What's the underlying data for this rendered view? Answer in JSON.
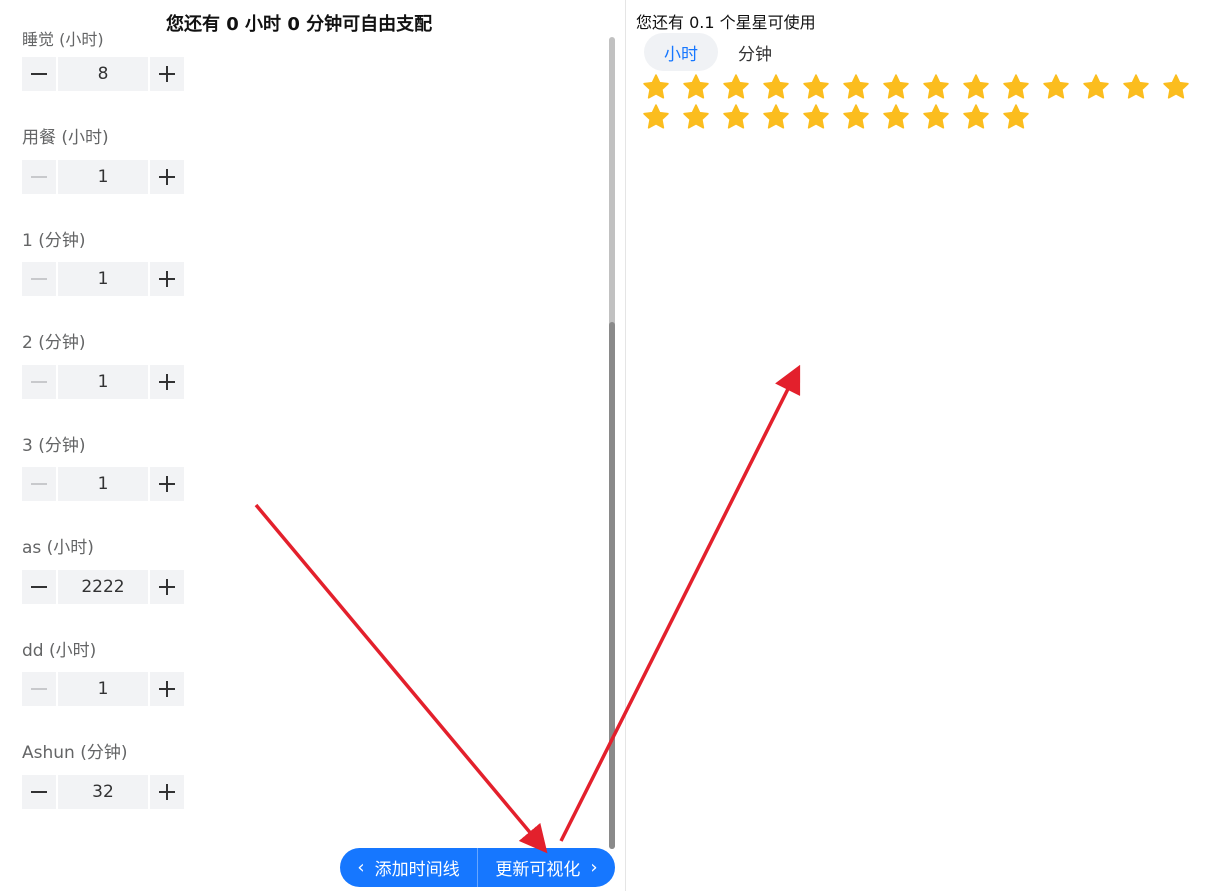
{
  "left": {
    "title": "您还有 0 小时 0 分钟可自由支配",
    "clipped_label": "睡觉 (小时)",
    "fields": [
      {
        "label": "",
        "value": "8"
      },
      {
        "label": "用餐 (小时)",
        "value": "1"
      },
      {
        "label": "1 (分钟)",
        "value": "1"
      },
      {
        "label": "2 (分钟)",
        "value": "1"
      },
      {
        "label": "3 (分钟)",
        "value": "1"
      },
      {
        "label": "as (小时)",
        "value": "2222"
      },
      {
        "label": "dd (小时)",
        "value": "1"
      },
      {
        "label": "Ashun (分钟)",
        "value": "32"
      }
    ]
  },
  "actions": {
    "add_timeline": "添加时间线",
    "update_visual": "更新可视化"
  },
  "right": {
    "title": "您还有 0.1 个星星可使用",
    "tabs": [
      "小时",
      "分钟"
    ],
    "active_tab": 0,
    "star_count": 24
  },
  "colors": {
    "accent": "#1677ff",
    "star": "#fbbd1e",
    "annotation_arrow": "#e3202c"
  },
  "icons": {
    "minus": "minus-icon",
    "plus": "plus-icon",
    "prev": "chevron-left-icon",
    "next": "chevron-right-icon",
    "star": "star-icon"
  }
}
